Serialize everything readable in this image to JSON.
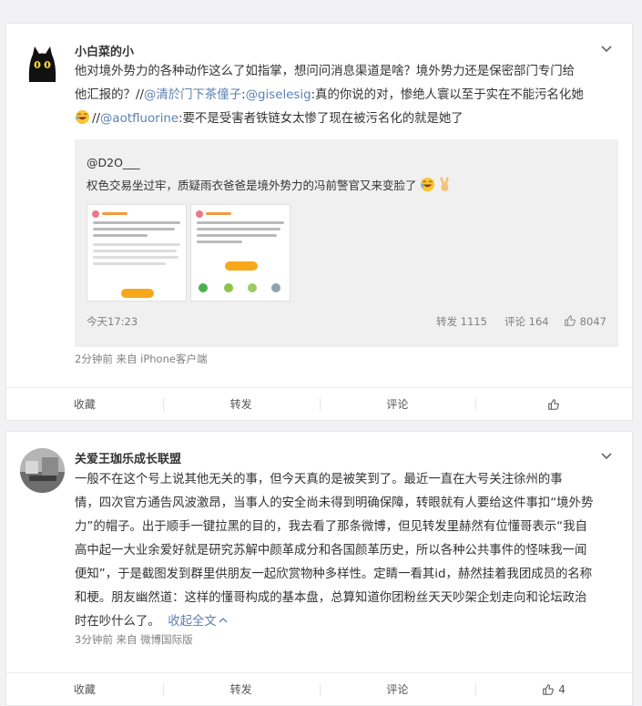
{
  "post1": {
    "username": "小白菜的小",
    "text_line1": "他对境外势力的各种动作这么了如指掌，想问问消息渠道是啥？境外势力还是保密部门专门给",
    "text_line2_pre": "他汇报的？//",
    "mention1": "@清於门下茶僮子",
    "text_line2_mid": ":",
    "mention2": "@giselesig",
    "text_line2_post": ":真的你说的对，惨绝人寰以至于实在不能污名化她",
    "text_line3_pre": "//",
    "mention3": "@aotfluorine",
    "text_line3_post": ":要不是受害者铁链女太惨了现在被污名化的就是她了",
    "repost": {
      "user": "@D2O___",
      "text": "权色交易坐过牢，质疑雨衣爸爸是境外势力的冯前警官又来变脸了",
      "time": "今天17:23",
      "reposts": "转发 1115",
      "comments": "评论 164",
      "likes": "8047"
    },
    "meta": "2分钟前  来自 iPhone客户端",
    "actions": {
      "collect": "收藏",
      "forward": "转发",
      "comment": "评论",
      "like": ""
    }
  },
  "post2": {
    "username": "关爱王珈乐成长联盟",
    "lines": [
      "一般不在这个号上说其他无关的事，但今天真的是被笑到了。最近一直在大号关注徐州的事",
      "情，四次官方通告风波激昂，当事人的安全尚未得到明确保障，转眼就有人要给这件事扣“境外势",
      "力”的帽子。出于顺手一键拉黑的目的，我去看了那条微博，但见转发里赫然有位懂哥表示“我自",
      "高中起一大业余爱好就是研究苏解中颜革成分和各国颜革历史，所以各种公共事件的怪味我一闻",
      "便知”，于是截图发到群里供朋友一起欣赏物种多样性。定睛一看其id，赫然挂着我团成员的名称",
      "和梗。朋友幽然道：这样的懂哥构成的基本盘，总算知道你团粉丝天天吵架企划走向和论坛政治"
    ],
    "last_line": "时在吵什么了。",
    "collapse": "收起全文",
    "meta": "3分钟前  来自 微博国际版",
    "actions": {
      "collect": "收藏",
      "forward": "转发",
      "comment": "评论",
      "like": "4"
    }
  },
  "colors": {
    "link": "#5b7fb3",
    "muted": "#808080",
    "accent": "#f7a81a"
  },
  "icons": [
    "chevron-down-icon",
    "like-icon",
    "laugh-emoji-icon",
    "victory-hand-icon",
    "chevron-up-icon"
  ]
}
